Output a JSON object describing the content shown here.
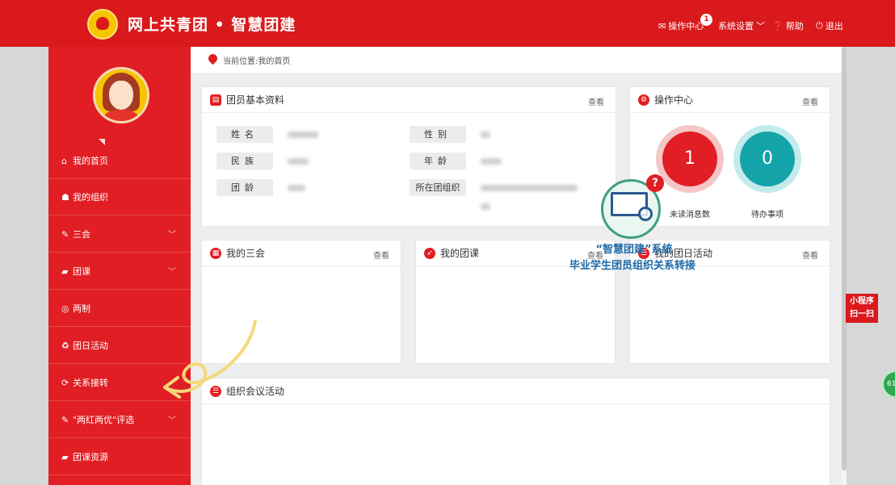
{
  "header": {
    "site_title": "网上共青团 • 智慧团建",
    "nav": [
      {
        "label": "操作中心",
        "icon": "mail-icon",
        "badge": "1"
      },
      {
        "label": "系统设置",
        "icon": "chevron-down-icon"
      },
      {
        "label": "帮助",
        "icon": "help-icon"
      },
      {
        "label": "退出",
        "icon": "power-icon"
      }
    ]
  },
  "sidebar": {
    "items": [
      {
        "label": "我的首页",
        "icon": "home-icon"
      },
      {
        "label": "我的组织",
        "icon": "users-icon"
      },
      {
        "label": "三会",
        "icon": "edit-icon"
      },
      {
        "label": "团课",
        "icon": "folder-icon"
      },
      {
        "label": "两制",
        "icon": "target-icon"
      },
      {
        "label": "团日活动",
        "icon": "recycle-icon"
      },
      {
        "label": "关系接转",
        "icon": "refresh-icon"
      },
      {
        "label": "\"两红两优\"评选",
        "icon": "edit-icon"
      },
      {
        "label": "团课资源",
        "icon": "folder-icon"
      }
    ]
  },
  "breadcrumb": "当前位置:我的首页",
  "profile_panel": {
    "title": "团员基本资料",
    "view": "查看",
    "fields": [
      {
        "label": "姓名"
      },
      {
        "label": "性别"
      },
      {
        "label": "民族"
      },
      {
        "label": "年龄"
      },
      {
        "label": "团龄"
      },
      {
        "label": "所在团组织"
      }
    ]
  },
  "ops_panel": {
    "title": "操作中心",
    "view": "查看",
    "unread_count": "1",
    "unread_label": "未读消息数",
    "todo_count": "0",
    "todo_label": "待办事项"
  },
  "panels": {
    "sanhui": {
      "title": "我的三会",
      "view": "查看"
    },
    "tuanke": {
      "title": "我的团课",
      "view": "查看"
    },
    "tuanri": {
      "title": "我的团日活动",
      "view": "查看"
    },
    "meeting": {
      "title": "组织会议活动"
    }
  },
  "overlay": {
    "title": "“智慧团建”系统",
    "subtitle": "毕业学生团员组织关系转接"
  },
  "side_widget": {
    "line1": "小程序",
    "line2": "扫一扫"
  },
  "float_ball": "61",
  "colors": {
    "primary_red": "#d9191c",
    "teal": "#14a3a8",
    "overlay_blue": "#1d6aa8"
  }
}
